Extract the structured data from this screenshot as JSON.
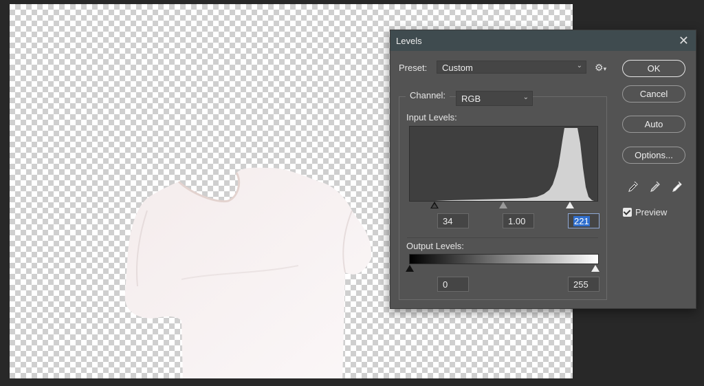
{
  "dialog": {
    "title": "Levels",
    "preset_label": "Preset:",
    "preset_value": "Custom",
    "channel_label": "Channel:",
    "channel_value": "RGB",
    "input_levels_label": "Input Levels:",
    "input_black": "34",
    "input_gamma": "1.00",
    "input_white": "221",
    "output_levels_label": "Output Levels:",
    "output_black": "0",
    "output_white": "255",
    "buttons": {
      "ok": "OK",
      "cancel": "Cancel",
      "auto": "Auto",
      "options": "Options..."
    },
    "preview_label": "Preview",
    "preview_checked": true
  },
  "icons": {
    "close": "close-icon",
    "gear": "gear-icon",
    "eyedroppers": [
      "black-point-eyedropper-icon",
      "gray-point-eyedropper-icon",
      "white-point-eyedropper-icon"
    ]
  },
  "colors": {
    "dialog_bg": "#535353",
    "titlebar": "#3f4b4f",
    "selection": "#2f6fcf"
  }
}
